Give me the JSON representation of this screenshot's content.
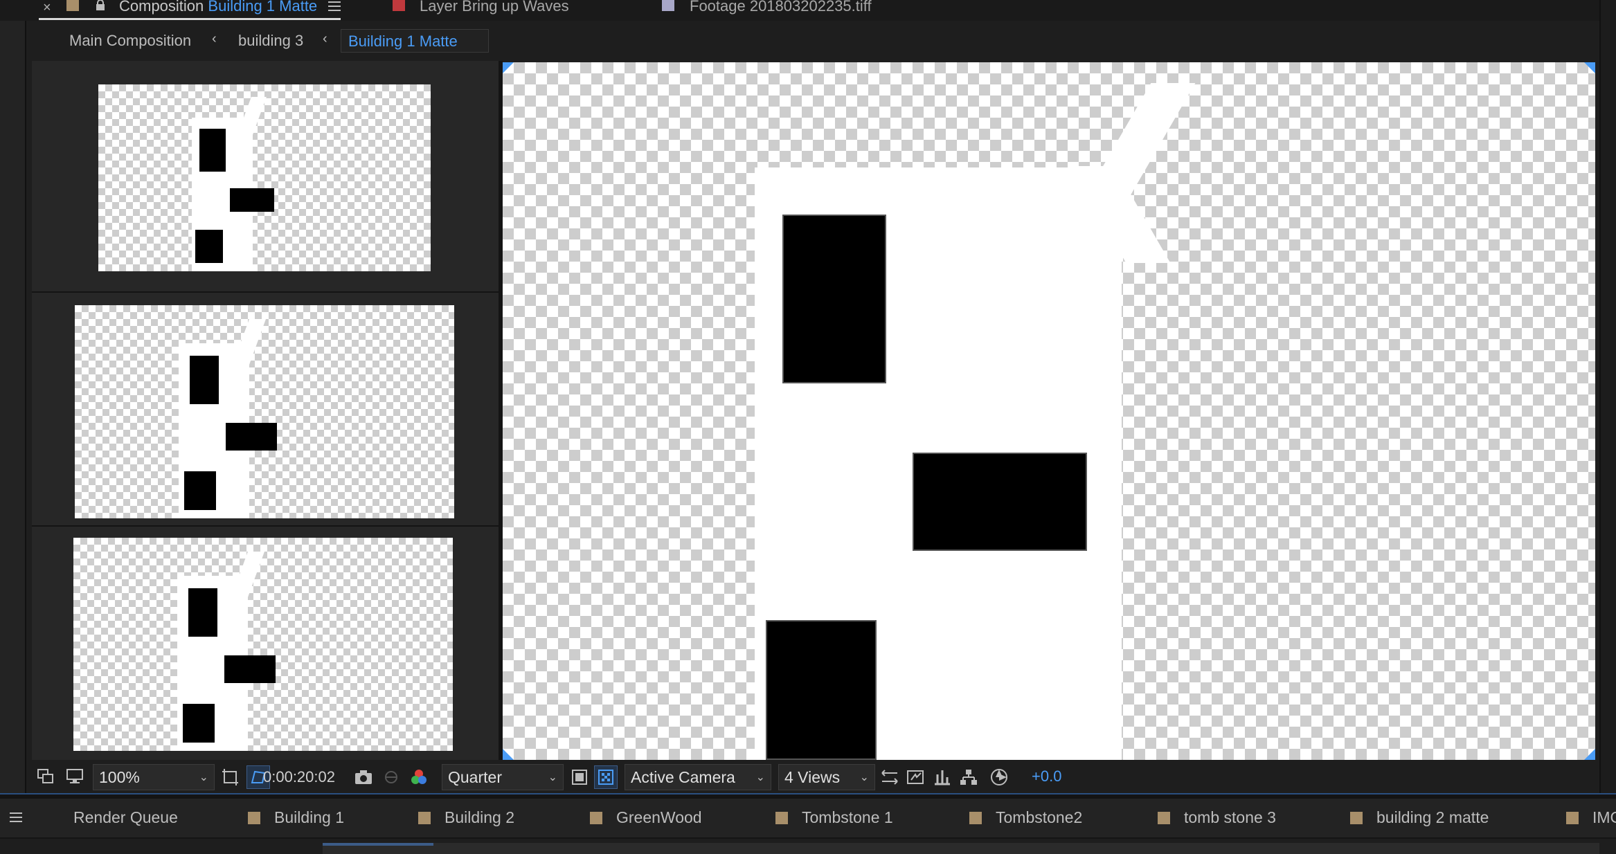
{
  "top_tabs": {
    "composition": {
      "prefix": "Composition",
      "name": "Building 1 Matte"
    },
    "layer": {
      "label": "Layer Bring up Waves",
      "color": "#c0393d"
    },
    "footage": {
      "label": "Footage 201803202235.tiff",
      "color": "#a8a7c8"
    }
  },
  "breadcrumb": {
    "items": [
      "Main Composition",
      "building 3",
      "Building 1 Matte"
    ],
    "active_color": "#4a9cf6"
  },
  "viewer_toolbar": {
    "zoom": "100%",
    "timecode": "0:00:20:02",
    "resolution": "Quarter",
    "camera": "Active Camera",
    "views": "4 Views",
    "exposure": "+0.0"
  },
  "bottom_tabs": [
    {
      "label": "Render Queue"
    },
    {
      "label": "Building 1"
    },
    {
      "label": "Building 2"
    },
    {
      "label": "GreenWood"
    },
    {
      "label": "Tombstone 1"
    },
    {
      "label": "Tombstone2"
    },
    {
      "label": "tomb stone 3"
    },
    {
      "label": "building 2 matte"
    },
    {
      "label": "IMG"
    }
  ],
  "icons": {
    "close": "close-icon",
    "lock": "lock-icon",
    "menu": "hamburger-icon",
    "chevron": "chevron-left-icon",
    "dropdown": "chevron-down-icon",
    "snapshot": "camera-icon",
    "color_channels": "rgb-channels-icon",
    "transparency_grid": "transparency-grid-icon",
    "region_of_interest": "region-of-interest-icon",
    "mask_visibility": "mask-icon",
    "reset_exposure": "exposure-icon"
  },
  "colors": {
    "accent_blue": "#4a9cf6",
    "panel_bg": "#232323",
    "comp_swatch": "#a88f6a"
  }
}
